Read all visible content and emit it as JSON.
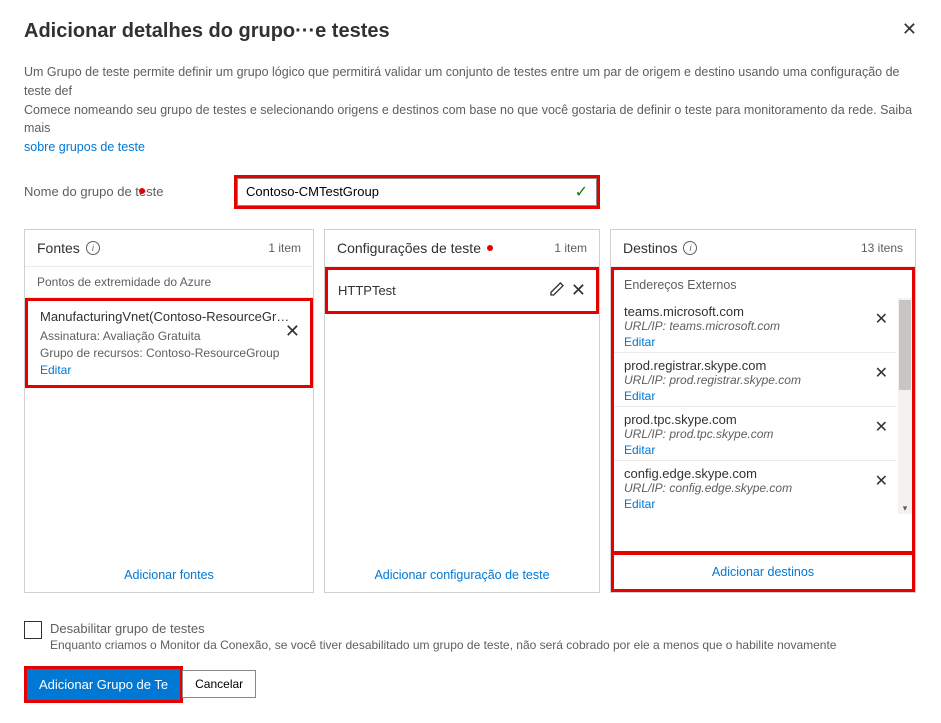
{
  "header": {
    "title": "Adicionar detalhes do grupo···e testes"
  },
  "description": {
    "line1": "Um Grupo de teste permite definir um grupo lógico que permitirá validar um conjunto de testes entre um par de origem e destino usando uma configuração de teste def",
    "line2": "Comece nomeando seu grupo de testes e selecionando origens e destinos com base no que você gostaria de definir o teste para monitoramento da rede. Saiba mais",
    "help_link": "sobre grupos de teste"
  },
  "name_field": {
    "label": "Nome do grupo de teste",
    "value": "Contoso-CMTestGroup"
  },
  "panels": {
    "sources": {
      "title": "Fontes",
      "count": "1 item",
      "sub_header": "Pontos de extremidade do Azure",
      "endpoint": {
        "name": "ManufacturingVnet(Contoso-ResourceGr…",
        "subscription_label": "Assinatura: Avaliação Gratuita",
        "rg_label": "Grupo de recursos: Contoso-ResourceGroup",
        "edit": "Editar"
      },
      "add_link": "Adicionar fontes"
    },
    "testcfg": {
      "title": "Configurações de teste",
      "count": "1 item",
      "config_name": "HTTPTest",
      "add_link": "Adicionar configuração de teste"
    },
    "destinations": {
      "title": "Destinos",
      "count": "13 itens",
      "group_header": "Endereços Externos",
      "items": [
        {
          "name": "teams.microsoft.com",
          "url": "URL/IP: teams.microsoft.com",
          "edit": "Editar"
        },
        {
          "name": "prod.registrar.skype.com",
          "url": "URL/IP: prod.registrar.skype.com",
          "edit": "Editar"
        },
        {
          "name": "prod.tpc.skype.com",
          "url": "URL/IP: prod.tpc.skype.com",
          "edit": "Editar"
        },
        {
          "name": "config.edge.skype.com",
          "url": "URL/IP: config.edge.skype.com",
          "edit": "Editar"
        }
      ],
      "add_link": "Adicionar destinos"
    }
  },
  "disable": {
    "label": "Desabilitar grupo de testes",
    "sub": "Enquanto criamos o Monitor da Conexão, se você tiver desabilitado um grupo de teste, não será cobrado por ele a menos que o habilite novamente"
  },
  "buttons": {
    "primary": "Adicionar Grupo de Te",
    "cancel": "Cancelar"
  }
}
